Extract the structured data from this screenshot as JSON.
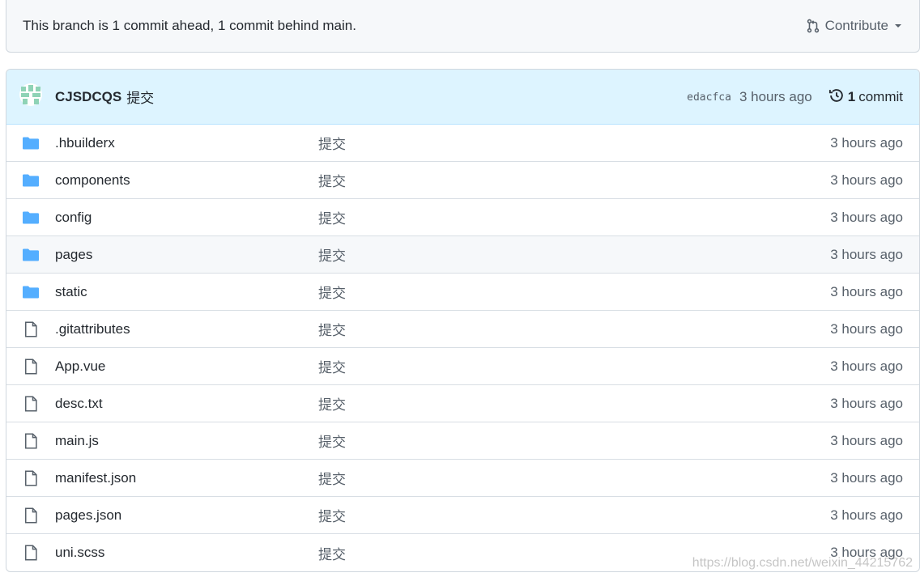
{
  "branch_bar": {
    "text": "This branch is 1 commit ahead, 1 commit behind main.",
    "contribute_label": "Contribute",
    "contribute_icon": "git-pull-request-icon",
    "dropdown_icon": "caret-down-icon"
  },
  "latest_commit": {
    "author": "CJSDCQS",
    "message": "提交",
    "sha": "edacfca",
    "time": "3 hours ago",
    "history_count": "1",
    "history_label": "commit",
    "history_icon": "history-icon"
  },
  "files": [
    {
      "type": "folder",
      "name": ".hbuilderx",
      "message": "提交",
      "age": "3 hours ago"
    },
    {
      "type": "folder",
      "name": "components",
      "message": "提交",
      "age": "3 hours ago"
    },
    {
      "type": "folder",
      "name": "config",
      "message": "提交",
      "age": "3 hours ago"
    },
    {
      "type": "folder",
      "name": "pages",
      "message": "提交",
      "age": "3 hours ago"
    },
    {
      "type": "folder",
      "name": "static",
      "message": "提交",
      "age": "3 hours ago"
    },
    {
      "type": "file",
      "name": ".gitattributes",
      "message": "提交",
      "age": "3 hours ago"
    },
    {
      "type": "file",
      "name": "App.vue",
      "message": "提交",
      "age": "3 hours ago"
    },
    {
      "type": "file",
      "name": "desc.txt",
      "message": "提交",
      "age": "3 hours ago"
    },
    {
      "type": "file",
      "name": "main.js",
      "message": "提交",
      "age": "3 hours ago"
    },
    {
      "type": "file",
      "name": "manifest.json",
      "message": "提交",
      "age": "3 hours ago"
    },
    {
      "type": "file",
      "name": "pages.json",
      "message": "提交",
      "age": "3 hours ago"
    },
    {
      "type": "file",
      "name": "uni.scss",
      "message": "提交",
      "age": "3 hours ago"
    }
  ],
  "watermark": "https://blog.csdn.net/weixin_44215762",
  "colors": {
    "folder": "#54aeff",
    "file_icon": "#57606a",
    "commit_header_bg": "#ddf4ff",
    "branch_bar_bg": "#f6f8fa"
  }
}
